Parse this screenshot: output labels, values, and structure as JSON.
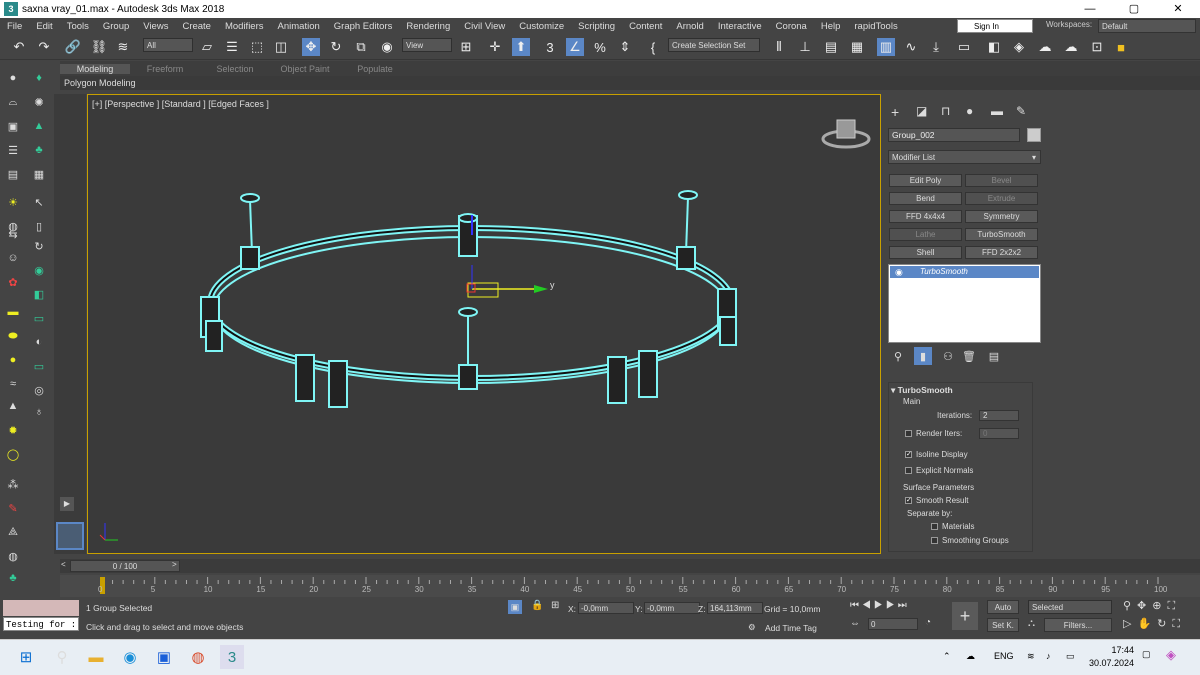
{
  "window": {
    "title": "saxna vray_01.max - Autodesk 3ds Max 2018",
    "app_icon": "3",
    "minimize": "—",
    "maximize": "▢",
    "close": "✕"
  },
  "menu": [
    "File",
    "Edit",
    "Tools",
    "Group",
    "Views",
    "Create",
    "Modifiers",
    "Animation",
    "Graph Editors",
    "Rendering",
    "Civil View",
    "Customize",
    "Scripting",
    "Content",
    "Arnold",
    "Interactive",
    "Corona",
    "Help",
    "rapidTools"
  ],
  "signin": "Sign In",
  "workspaces_label": "Workspaces:",
  "workspace_value": "Default",
  "toolbar": {
    "selection_filter": "All",
    "ref_coord": "View",
    "selection_set": "Create Selection Set",
    "icons": [
      "undo-icon",
      "redo-icon",
      "link-icon",
      "unlink-icon",
      "bind-spacewarp-icon",
      "select-icon",
      "select-by-name-icon",
      "rect-region-icon",
      "window-crossing-icon",
      "move-icon",
      "rotate-icon",
      "scale-icon",
      "select-place-icon",
      "pivot-icon",
      "select-manipulate-icon",
      "keyboard-shortcut-icon",
      "snap-3d-icon",
      "angle-snap-icon",
      "percent-snap-icon",
      "spinner-snap-icon",
      "edit-named-sel-icon",
      "mirror-icon",
      "align-icon",
      "layer-explorer-icon",
      "toggle-ribbon-icon",
      "curve-editor-icon",
      "schematic-view-icon",
      "material-editor-icon",
      "render-setup-icon",
      "rendered-frame-icon",
      "render-icon",
      "render-cloud-icon",
      "a360-icon",
      "folder-icon"
    ]
  },
  "ribbon": {
    "tabs": [
      "Modeling",
      "Freeform",
      "Selection",
      "Object Paint",
      "Populate"
    ],
    "active_tab": "Modeling",
    "panel_label": "Polygon Modeling"
  },
  "viewport": {
    "label": "[+] [Perspective ] [Standard ] [Edged Faces ]",
    "axis_y_label": "y",
    "wire_color": "#7ff5f5"
  },
  "command_panel": {
    "object_name": "Group_002",
    "modifier_list": "Modifier List",
    "modifier_buttons": [
      {
        "label": "Edit Poly",
        "enabled": true
      },
      {
        "label": "Bevel",
        "enabled": false
      },
      {
        "label": "Bend",
        "enabled": true
      },
      {
        "label": "Extrude",
        "enabled": false
      },
      {
        "label": "FFD 4x4x4",
        "enabled": true
      },
      {
        "label": "Symmetry",
        "enabled": true
      },
      {
        "label": "Lathe",
        "enabled": false
      },
      {
        "label": "TurboSmooth",
        "enabled": true
      },
      {
        "label": "Shell",
        "enabled": true
      },
      {
        "label": "FFD 2x2x2",
        "enabled": true
      }
    ],
    "stack_item": "TurboSmooth",
    "rollout": {
      "title": "TurboSmooth",
      "main": "Main",
      "iterations_label": "Iterations:",
      "iterations_value": "2",
      "render_iters_label": "Render Iters:",
      "render_iters_value": "0",
      "isoline_label": "Isoline Display",
      "explicit_normals_label": "Explicit Normals",
      "surface_params": "Surface Parameters",
      "smooth_result": "Smooth Result",
      "separate_by": "Separate by:",
      "materials": "Materials",
      "smoothing_groups": "Smoothing Groups"
    }
  },
  "timeline": {
    "slider": "0 / 100",
    "ticks": [
      "0",
      "5",
      "10",
      "15",
      "20",
      "25",
      "30",
      "35",
      "40",
      "45",
      "50",
      "55",
      "60",
      "65",
      "70",
      "75",
      "80",
      "85",
      "90",
      "95",
      "100"
    ]
  },
  "status": {
    "maxscript_input": "Testing for :",
    "selected": "1 Group Selected",
    "prompt": "Click and drag to select and move objects",
    "x_label": "X:",
    "x_value": "-0,0mm",
    "y_label": "Y:",
    "y_value": "-0,0mm",
    "z_label": "Z:",
    "z_value": "164,113mm",
    "grid": "Grid = 10,0mm",
    "add_time_tag": "Add Time Tag",
    "auto": "Auto",
    "set_key": "Set K.",
    "key_filter": "Selected",
    "filters": "Filters...",
    "frame_value": "0"
  },
  "taskbar": {
    "lang": "ENG",
    "time": "17:44",
    "date": "30.07.2024"
  }
}
